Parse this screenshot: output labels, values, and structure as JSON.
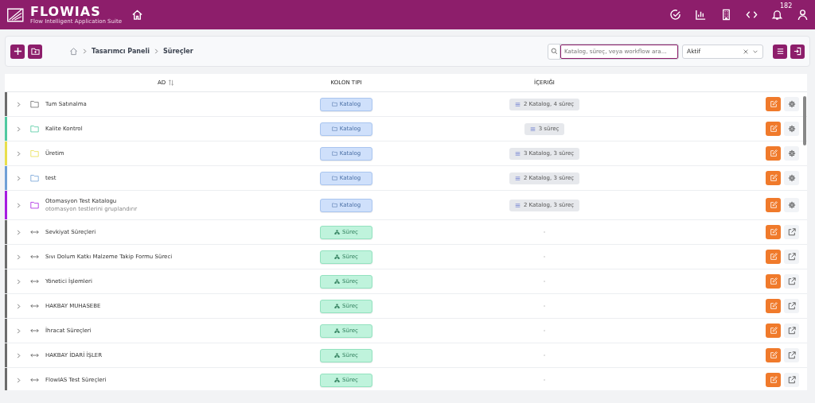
{
  "header": {
    "logo": "FLOWIAS",
    "tagline": "Flow Intelligent Application Suite",
    "notification_count": "182"
  },
  "toolbar": {
    "breadcrumb": [
      "Tasarımcı Paneli",
      "Süreçler"
    ],
    "search": {
      "placeholder": "Katalog, süreç, veya workflow ara..."
    },
    "status_filter": "Aktif"
  },
  "table": {
    "columns": [
      "AD",
      "KOLON TIPI",
      "İÇERIĞI"
    ],
    "rows": [
      {
        "kind": "catalog",
        "name": "Tum Satınalma",
        "type": "Katalog",
        "content": "2 Katalog, 4 süreç",
        "color": "#6b6b6b"
      },
      {
        "kind": "catalog",
        "name": "Kalite Kontrol",
        "type": "Katalog",
        "content": "3 süreç",
        "color": "#4fc9a0"
      },
      {
        "kind": "catalog",
        "name": "Üretim",
        "type": "Katalog",
        "content": "3 Katalog, 3 süreç",
        "color": "#e8df4c"
      },
      {
        "kind": "catalog",
        "name": "test",
        "type": "Katalog",
        "content": "2 Katalog, 3 süreç",
        "color": "#6f9fd6"
      },
      {
        "kind": "catalog",
        "name": "Otomasyon Test Katalogu",
        "description": "otomasyon testlerini gruplandırır",
        "type": "Katalog",
        "content": "2 Katalog, 3 süreç",
        "color": "#a61ce0"
      },
      {
        "kind": "process",
        "name": "Sevkiyat Süreçleri",
        "type": "Süreç",
        "content": "-",
        "color": "#6b6b6b"
      },
      {
        "kind": "process",
        "name": "Sıvı Dolum Katkı Malzeme Takip Formu Süreci",
        "type": "Süreç",
        "content": "-",
        "color": "#6b6b6b"
      },
      {
        "kind": "process",
        "name": "Yönetici İşlemleri",
        "type": "Süreç",
        "content": "-",
        "color": "#6b6b6b"
      },
      {
        "kind": "process",
        "name": "HAKBAY MUHASEBE",
        "type": "Süreç",
        "content": "-",
        "color": "#6b6b6b"
      },
      {
        "kind": "process",
        "name": "İhracat Süreçleri",
        "type": "Süreç",
        "content": "-",
        "color": "#6b6b6b"
      },
      {
        "kind": "process",
        "name": "HAKBAY İDARİ İŞLER",
        "type": "Süreç",
        "content": "-",
        "color": "#6b6b6b"
      },
      {
        "kind": "process",
        "name": "FlowIAS Test Süreçleri",
        "type": "Süreç",
        "content": "-",
        "color": "#6b6b6b"
      }
    ]
  }
}
